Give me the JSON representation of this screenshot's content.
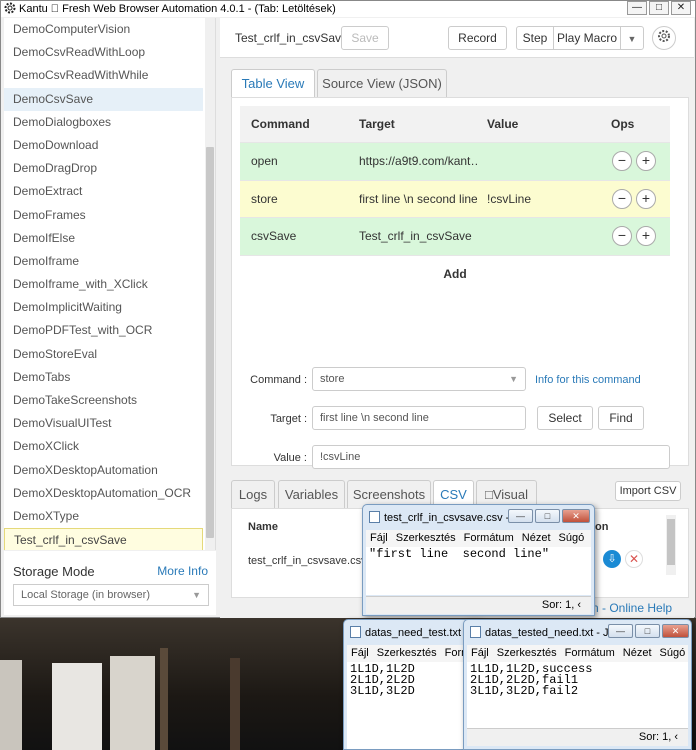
{
  "window": {
    "title": "Kantu \u0000 Fresh Web Browser Automation 4.0.1 - (Tab: Letöltések)",
    "controls": [
      "—",
      "□",
      "✕"
    ]
  },
  "sidebar": {
    "items": [
      {
        "label": "DemoComputerVision"
      },
      {
        "label": "DemoCsvReadWithLoop"
      },
      {
        "label": "DemoCsvReadWithWhile"
      },
      {
        "label": "DemoCsvSave"
      },
      {
        "label": "DemoDialogboxes"
      },
      {
        "label": "DemoDownload"
      },
      {
        "label": "DemoDragDrop"
      },
      {
        "label": "DemoExtract"
      },
      {
        "label": "DemoFrames"
      },
      {
        "label": "DemoIfElse"
      },
      {
        "label": "DemoIframe"
      },
      {
        "label": "DemoIframe_with_XClick"
      },
      {
        "label": "DemoImplicitWaiting"
      },
      {
        "label": "DemoPDFTest_with_OCR"
      },
      {
        "label": "DemoStoreEval"
      },
      {
        "label": "DemoTabs"
      },
      {
        "label": "DemoTakeScreenshots"
      },
      {
        "label": "DemoVisualUITest"
      },
      {
        "label": "DemoXClick"
      },
      {
        "label": "DemoXDesktopAutomation"
      },
      {
        "label": "DemoXDesktopAutomation_OCR"
      },
      {
        "label": "DemoXType"
      },
      {
        "label": "Test_crlf_in_csvSave"
      }
    ],
    "selected_index": 3,
    "current_index": 22
  },
  "storage": {
    "label": "Storage Mode",
    "more_info": "More Info",
    "selected": "Local Storage (in browser)"
  },
  "toolbar": {
    "macro_name": "Test_crlf_in_csvSave",
    "save": "Save",
    "record": "Record",
    "step": "Step",
    "play_macro": "Play Macro"
  },
  "view_tabs": [
    "Table View",
    "Source View (JSON)"
  ],
  "table": {
    "headers": {
      "command": "Command",
      "target": "Target",
      "value": "Value",
      "ops": "Ops"
    },
    "rows": [
      {
        "command": "open",
        "target": "https://a9t9.com/kant…",
        "value": ""
      },
      {
        "command": "store",
        "target": "first line \\n second line",
        "value": "!csvLine"
      },
      {
        "command": "csvSave",
        "target": "Test_crlf_in_csvSave",
        "value": ""
      }
    ],
    "add_label": "Add",
    "minus": "−",
    "plus": "+"
  },
  "form": {
    "command_label": "Command :",
    "command_value": "store",
    "info_link": "Info for this command",
    "target_label": "Target :",
    "target_value": "first line \\n second line",
    "select_btn": "Select",
    "find_btn": "Find",
    "value_label": "Value :",
    "value_value": "!csvLine"
  },
  "bottom_tabs": [
    "Logs",
    "Variables",
    "Screenshots",
    "CSV",
    "□Visual"
  ],
  "import_csv": "Import CSV",
  "csv_table": {
    "header_name": "Name",
    "header_action": "ion",
    "file": "test_crlf_in_csvsave.csv"
  },
  "footer_link": "n - Online Help",
  "notepad1": {
    "title": "test_crlf_in_csvsave.csv - ...",
    "menu": [
      "Fájl",
      "Szerkesztés",
      "Formátum",
      "Nézet",
      "Súgó"
    ],
    "content": "\"first line  second line\"",
    "status": "Sor: 1, ‹"
  },
  "notepad2": {
    "title": "datas_need_test.txt - J",
    "menu": [
      "Fájl",
      "Szerkesztés",
      "Form"
    ],
    "content": "1L1D,1L2D\n2L1D,2L2D\n3L1D,3L2D"
  },
  "notepad3": {
    "title": "datas_tested_need.txt - Je...",
    "menu": [
      "Fájl",
      "Szerkesztés",
      "Formátum",
      "Nézet",
      "Súgó"
    ],
    "content": "1L1D,1L2D,success\n2L1D,2L2D,fail1\n3L1D,3L2D,fail2",
    "status": "Sor: 1, ‹"
  },
  "colors": {
    "accent": "#2a7ab8",
    "row_green": "#d9f7db",
    "row_yellow": "#fcfcd0",
    "download_btn": "#1a8ad4",
    "delete_btn": "#d9534f"
  }
}
